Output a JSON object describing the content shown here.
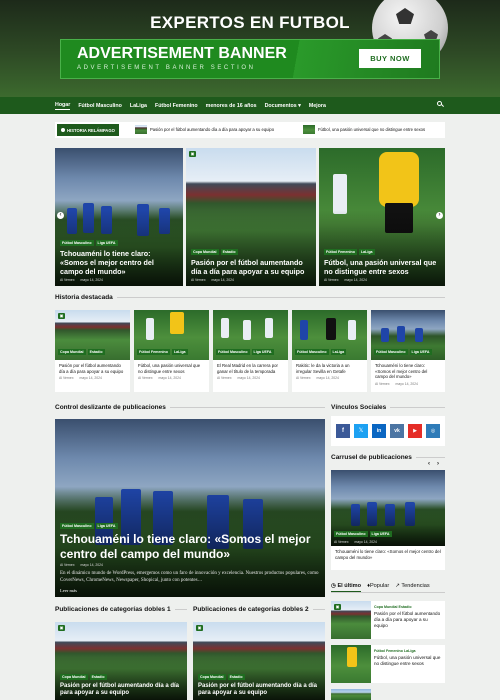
{
  "header": {
    "site_title": "EXPERTOS EN FUTBOL",
    "ad_title": "ADVERTISEMENT BANNER",
    "ad_subtitle": "ADVERTISEMENT BANNER SECTION",
    "ad_button": "BUY NOW"
  },
  "nav": {
    "items": [
      "Hogar",
      "Fútbol Masculino",
      "LaLiga",
      "Fútbol Femenino",
      "menores de 16 años",
      "Documentos",
      "Mejora"
    ]
  },
  "ticker": {
    "label": "HISTORIA RELÁMPAGO",
    "items": [
      "Pasión por el fútbol aumentando día a día para apoyar a su equipo",
      "Fútbol, una pasión universal que no distingue entre sexos"
    ]
  },
  "hero": [
    {
      "tags": [
        "Fútbol Masculino",
        "Liga UEFA"
      ],
      "title": "Tchouaméni lo tiene claro: «Somos el mejor centro del campo del mundo»",
      "author": "Al Vernex",
      "date": "mayo 14, 2024"
    },
    {
      "tags": [
        "Copa Mundial",
        "Estadio"
      ],
      "title": "Pasión por el fútbol aumentando día a día para apoyar a su equipo",
      "author": "Al Vernex",
      "date": "mayo 14, 2024"
    },
    {
      "tags": [
        "Fútbol Femenino",
        "LaLiga"
      ],
      "title": "Fútbol, una pasión universal que no distingue entre sexos",
      "author": "Al Vernex",
      "date": "mayo 14, 2024"
    }
  ],
  "featured": {
    "heading": "Historia destacada",
    "cards": [
      {
        "tags": [
          "Copa Mundial",
          "Estadio"
        ],
        "title": "Pasión por el fútbol aumentando día a día para apoyar a su equipo",
        "author": "Al Vernex",
        "date": "mayo 14, 2024"
      },
      {
        "tags": [
          "Fútbol Femenino",
          "LaLiga"
        ],
        "title": "Fútbol, una pasión universal que no distingue entre sexos",
        "author": "Al Vernex",
        "date": "mayo 14, 2024"
      },
      {
        "tags": [
          "Fútbol Masculino",
          "Liga UEFA"
        ],
        "title": "El Real Madrid en la carrera por ganar el título de la temporada",
        "author": "Al Vernex",
        "date": "mayo 14, 2024"
      },
      {
        "tags": [
          "Fútbol Masculino",
          "LaLiga"
        ],
        "title": "Rakitic: le da la victoria a un irregular Sevilla en Getafe",
        "author": "Al Vernex",
        "date": "mayo 14, 2024"
      },
      {
        "tags": [
          "Fútbol Masculino",
          "Liga UEFA"
        ],
        "title": "Tchouaméni lo tiene claro: «Somos el mejor centro del campo del mundo»",
        "author": "Al Vernex",
        "date": "mayo 14, 2024"
      }
    ]
  },
  "slider": {
    "heading": "Control deslizante de publicaciones",
    "tags": [
      "Fútbol Masculino",
      "Liga UEFA"
    ],
    "title": "Tchouaméni lo tiene claro: «Somos el mejor centro del campo del mundo»",
    "author": "Al Vernex",
    "date": "mayo 14, 2024",
    "excerpt": "En el dinámico mundo de WordPress, emergemos como un faro de innovación y excelencia. Nuestros productos populares, como CoverNews, ChromeNews, Newspaper, Shopical, junto con potentes…",
    "read_more": "Leer más"
  },
  "social": {
    "heading": "Vínculos Sociales",
    "icons": [
      "f",
      "𝕏",
      "in",
      "vk",
      "▶",
      "◎"
    ],
    "colors": [
      "#3b5998",
      "#1da1f2",
      "#0a66c2",
      "#4c75a3",
      "#e52d27",
      "#2e7bb8"
    ]
  },
  "carousel": {
    "heading": "Carrusel de publicaciones",
    "tags": [
      "Fútbol Masculino",
      "Liga UEFA"
    ],
    "author": "Al Vernex",
    "date": "mayo 14, 2024",
    "title": "Tchouaméni lo tiene claro: «Somos el mejor centro del campo del mundo»"
  },
  "tabs": {
    "items": [
      "El último",
      "Popular",
      "Tendencias"
    ],
    "posts": [
      {
        "tags": "Copa Mundial  Estadio",
        "title": "Pasión por el fútbol aumentando día a día para apoyar a su equipo"
      },
      {
        "tags": "Fútbol Femenino  LaLiga",
        "title": "Fútbol, una pasión universal que no distingue entre sexos"
      }
    ]
  },
  "double": [
    {
      "heading": "Publicaciones de categorías dobles 1",
      "tags": [
        "Copa Mundial",
        "Estadio"
      ],
      "title": "Pasión por el fútbol aumentando día a día para apoyar a su equipo"
    },
    {
      "heading": "Publicaciones de categorías dobles 2",
      "tags": [
        "Copa Mundial",
        "Estadio"
      ],
      "title": "Pasión por el fútbol aumentando día a día para apoyar a su equipo"
    }
  ]
}
